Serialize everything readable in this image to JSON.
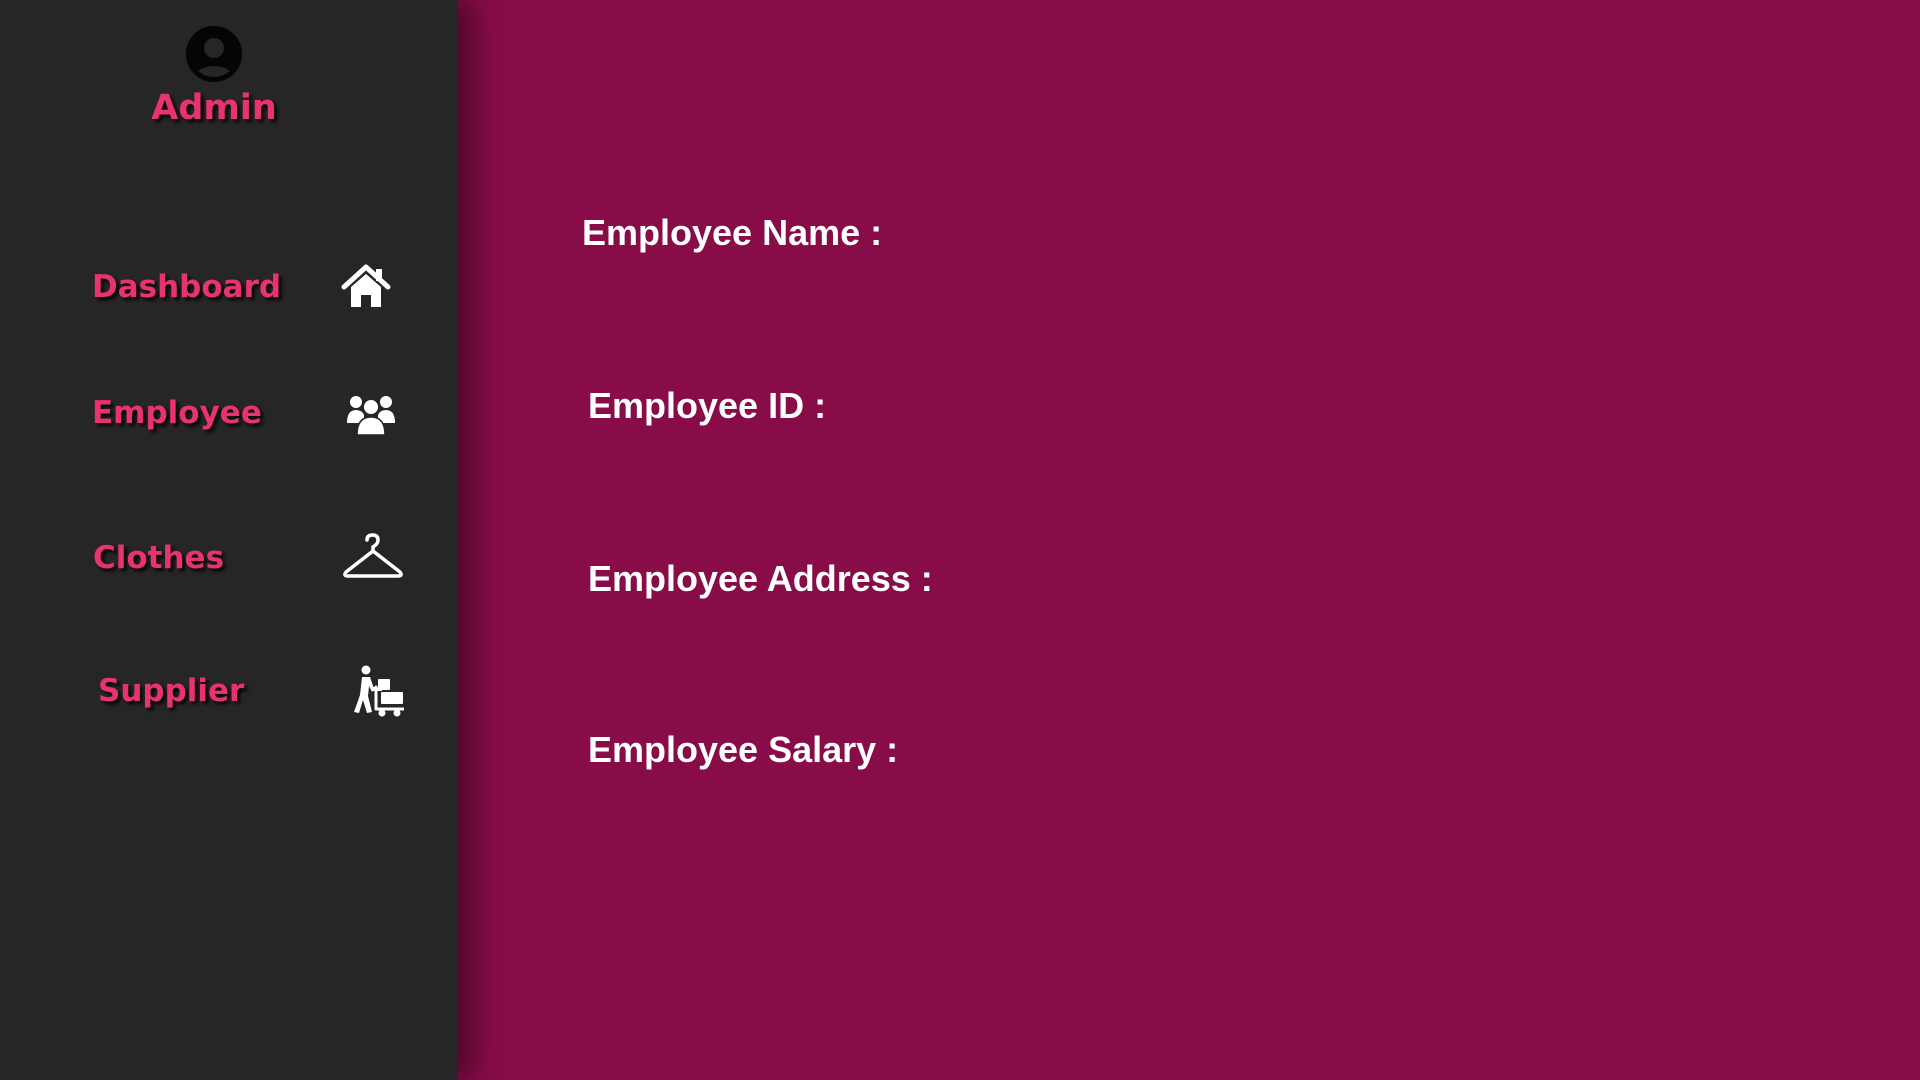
{
  "sidebar": {
    "user": {
      "avatar_icon": "user-circle-icon",
      "name": "Admin"
    },
    "items": [
      {
        "label": "Dashboard",
        "icon": "home-icon"
      },
      {
        "label": "Employee",
        "icon": "users-group-icon"
      },
      {
        "label": "Clothes",
        "icon": "hanger-icon"
      },
      {
        "label": "Supplier",
        "icon": "delivery-person-cart-icon"
      }
    ]
  },
  "main": {
    "fields": [
      {
        "label": "Employee Name :"
      },
      {
        "label": "Employee ID :"
      },
      {
        "label": "Employee Address :"
      },
      {
        "label": "Employee Salary :"
      }
    ]
  },
  "colors": {
    "sidebar_background": "#262628",
    "main_background": "#870c48",
    "accent_text": "#e83272",
    "label_text": "#ffffff"
  }
}
